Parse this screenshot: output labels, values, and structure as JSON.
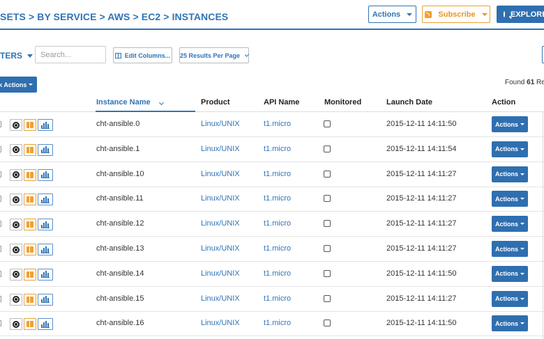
{
  "breadcrumb": [
    "SETS",
    "BY SERVICE",
    "AWS",
    "EC2",
    "INSTANCES"
  ],
  "header_buttons": {
    "actions": "Actions",
    "subscribe": "Subscribe",
    "explorer": "EXPLORER"
  },
  "toolbar": {
    "filters": "TERS",
    "search_placeholder": "Search...",
    "edit_columns": "Edit Columns...",
    "per_page": "25 Results Per Page"
  },
  "bulk_actions": "lk Actions",
  "found": {
    "prefix": "Found",
    "count": "61",
    "suffix": "Resul"
  },
  "columns": {
    "name": "Instance Name",
    "product": "Product",
    "api": "API Name",
    "monitored": "Monitored",
    "launch": "Launch Date",
    "action": "Action"
  },
  "row_action_label": "Actions",
  "rows": [
    {
      "name": "cht-ansible.0",
      "product": "Linux/UNIX",
      "api": "t1.micro",
      "monitored": false,
      "launch": "2015-12-11 14:11:50"
    },
    {
      "name": "cht-ansible.1",
      "product": "Linux/UNIX",
      "api": "t1.micro",
      "monitored": false,
      "launch": "2015-12-11 14:11:54"
    },
    {
      "name": "cht-ansible.10",
      "product": "Linux/UNIX",
      "api": "t1.micro",
      "monitored": false,
      "launch": "2015-12-11 14:11:27"
    },
    {
      "name": "cht-ansible.11",
      "product": "Linux/UNIX",
      "api": "t1.micro",
      "monitored": false,
      "launch": "2015-12-11 14:11:27"
    },
    {
      "name": "cht-ansible.12",
      "product": "Linux/UNIX",
      "api": "t1.micro",
      "monitored": false,
      "launch": "2015-12-11 14:11:27"
    },
    {
      "name": "cht-ansible.13",
      "product": "Linux/UNIX",
      "api": "t1.micro",
      "monitored": false,
      "launch": "2015-12-11 14:11:27"
    },
    {
      "name": "cht-ansible.14",
      "product": "Linux/UNIX",
      "api": "t1.micro",
      "monitored": false,
      "launch": "2015-12-11 14:11:50"
    },
    {
      "name": "cht-ansible.15",
      "product": "Linux/UNIX",
      "api": "t1.micro",
      "monitored": false,
      "launch": "2015-12-11 14:11:27"
    },
    {
      "name": "cht-ansible.16",
      "product": "Linux/UNIX",
      "api": "t1.micro",
      "monitored": false,
      "launch": "2015-12-11 14:11:50"
    }
  ],
  "colors": {
    "accent": "#2f74b5",
    "button_blue": "#2f6fb0",
    "subscribe_orange": "#f0a030"
  },
  "icons": [
    "target-icon",
    "aws-cube-icon",
    "bar-chart-icon",
    "caret-down-icon",
    "rss-icon",
    "search-icon",
    "columns-icon",
    "chevron-down-icon"
  ]
}
